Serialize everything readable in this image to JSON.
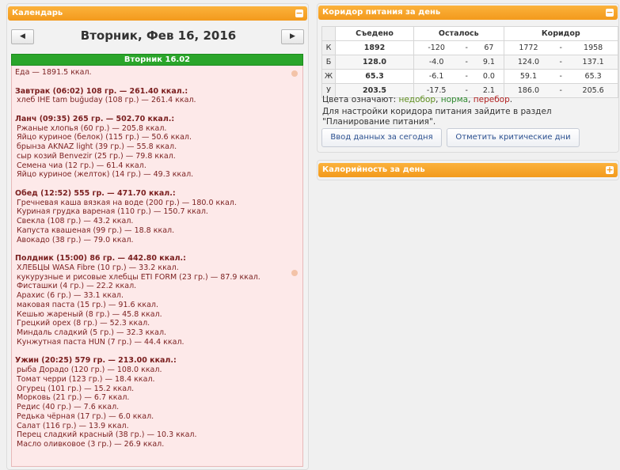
{
  "calendar": {
    "title": "Календарь",
    "toggle": "−",
    "prev": "◀",
    "next": "▶",
    "date": "Вторник, Фев 16, 2016",
    "day_label": "Вторник 16.02",
    "lines": [
      {
        "text": "Еда — 1891.5 ккал.",
        "kind": "head"
      },
      {
        "text": "",
        "kind": "gap"
      },
      {
        "text": "Завтрак (06:02) 108 гр. — 261.40 ккал.:",
        "kind": "meal"
      },
      {
        "text": "хлеб IHE tam buğuday (108 гр.) — 261.4 ккал.",
        "kind": "item"
      },
      {
        "text": "",
        "kind": "gap"
      },
      {
        "text": "Ланч (09:35) 265 гр. — 502.70 ккал.:",
        "kind": "meal"
      },
      {
        "text": "Ржаные хлопья (60 гр.) — 205.8 ккал.",
        "kind": "item"
      },
      {
        "text": "Яйцо куриное (белок) (115 гр.) — 50.6 ккал.",
        "kind": "item"
      },
      {
        "text": "брынза AKNAZ light (39 гр.) — 55.8 ккал.",
        "kind": "item"
      },
      {
        "text": "сыр козий Benvezir (25 гр.) — 79.8 ккал.",
        "kind": "item"
      },
      {
        "text": "Семена чиа (12 гр.) — 61.4 ккал.",
        "kind": "item"
      },
      {
        "text": "Яйцо куриное (желток) (14 гр.) — 49.3 ккал.",
        "kind": "item"
      },
      {
        "text": "",
        "kind": "gap"
      },
      {
        "text": "Обед (12:52) 555 гр. — 471.70 ккал.:",
        "kind": "meal"
      },
      {
        "text": "Гречневая каша вязкая на воде (200 гр.) — 180.0 ккал.",
        "kind": "item"
      },
      {
        "text": "Куриная грудка вареная (110 гр.) — 150.7 ккал.",
        "kind": "item"
      },
      {
        "text": "Свекла (108 гр.) — 43.2 ккал.",
        "kind": "item"
      },
      {
        "text": "Капуста квашеная (99 гр.) — 18.8 ккал.",
        "kind": "item"
      },
      {
        "text": "Авокадо (38 гр.) — 79.0 ккал.",
        "kind": "item"
      },
      {
        "text": "",
        "kind": "gap"
      },
      {
        "text": "Полдник (15:00) 86 гр. — 442.80 ккал.:",
        "kind": "meal"
      },
      {
        "text": "ХЛЕБЦЫ WASA Fibre (10 гр.) — 33.2 ккал.",
        "kind": "item"
      },
      {
        "text": "кукурузные и рисовые хлебцы ETI FORM (23 гр.) — 87.9 ккал.",
        "kind": "item"
      },
      {
        "text": "Фисташки (4 гр.) — 22.2 ккал.",
        "kind": "item"
      },
      {
        "text": "Арахис (6 гр.) — 33.1 ккал.",
        "kind": "item"
      },
      {
        "text": "маковая паста (15 гр.) — 91.6 ккал.",
        "kind": "item"
      },
      {
        "text": "Кешью жареный (8 гр.) — 45.8 ккал.",
        "kind": "item"
      },
      {
        "text": "Грецкий орех (8 гр.) — 52.3 ккал.",
        "kind": "item"
      },
      {
        "text": "Миндаль сладкий (5 гр.) — 32.3 ккал.",
        "kind": "item"
      },
      {
        "text": "Кунжутная паста HUN (7 гр.) — 44.4 ккал.",
        "kind": "item"
      },
      {
        "text": "",
        "kind": "gap"
      },
      {
        "text": "Ужин (20:25) 579 гр. — 213.00 ккал.:",
        "kind": "meal"
      },
      {
        "text": "рыба Дорадо (120 гр.) — 108.0 ккал.",
        "kind": "item"
      },
      {
        "text": "Томат черри (123 гр.) — 18.4 ккал.",
        "kind": "item"
      },
      {
        "text": "Огурец (101 гр.) — 15.2 ккал.",
        "kind": "item"
      },
      {
        "text": "Морковь (21 гр.) — 6.7 ккал.",
        "kind": "item"
      },
      {
        "text": "Редис (40 гр.) — 7.6 ккал.",
        "kind": "item"
      },
      {
        "text": "Редька чёрная (17 гр.) — 6.0 ккал.",
        "kind": "item"
      },
      {
        "text": "Салат (116 гр.) — 13.9 ккал.",
        "kind": "item"
      },
      {
        "text": "Перец сладкий красный (38 гр.) — 10.3 ккал.",
        "kind": "item"
      },
      {
        "text": "Масло оливковое (3 гр.) — 26.9 ккал.",
        "kind": "item"
      }
    ]
  },
  "corridor": {
    "title": "Коридор питания за день",
    "toggle": "−",
    "headers": [
      "",
      "Съедено",
      "Осталось",
      "Коридор"
    ],
    "rows": [
      {
        "label": "К",
        "eaten": "1892",
        "rem_a": "-120",
        "rem_sep": "-",
        "rem_b": "67",
        "cor_a": "1772",
        "cor_sep": "-",
        "cor_b": "1958"
      },
      {
        "label": "Б",
        "eaten": "128.0",
        "rem_a": "-4.0",
        "rem_sep": "-",
        "rem_b": "9.1",
        "cor_a": "124.0",
        "cor_sep": "-",
        "cor_b": "137.1"
      },
      {
        "label": "Ж",
        "eaten": "65.3",
        "rem_a": "-6.1",
        "rem_sep": "-",
        "rem_b": "0.0",
        "cor_a": "59.1",
        "cor_sep": "-",
        "cor_b": "65.3"
      },
      {
        "label": "У",
        "eaten": "203.5",
        "rem_a": "-17.5",
        "rem_sep": "-",
        "rem_b": "2.1",
        "cor_a": "186.0",
        "cor_sep": "-",
        "cor_b": "205.6"
      }
    ],
    "legend_prefix": "Цвета означают:",
    "legend_under": "недобор",
    "legend_norm": "норма",
    "legend_over": "перебор",
    "legend_comma": ",",
    "legend_end": ".",
    "hint_line1": "Для настройки коридора питания зайдите в раздел",
    "hint_line2": "\"Планирование питания\".",
    "btn_today": "Ввод данных за сегодня",
    "btn_critical": "Отметить критические дни"
  },
  "calories": {
    "title": "Калорийность за день",
    "toggle": "+"
  }
}
